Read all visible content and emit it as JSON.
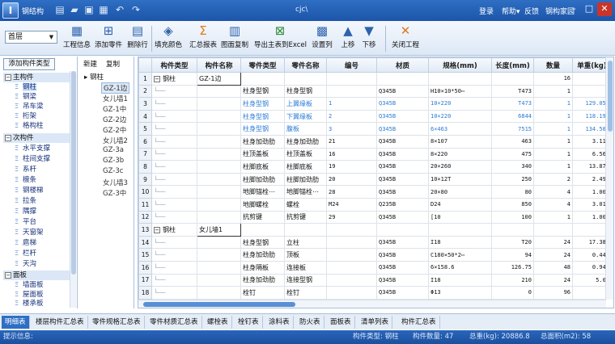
{
  "app": {
    "name": "钢结构",
    "window_title": "cjc\\",
    "menu_right": [
      "登录",
      "帮助",
      "反馈",
      "钢构家园"
    ]
  },
  "toolbar": {
    "floor": "首层",
    "buttons": [
      {
        "label": "工程信息",
        "icon": "table-icon"
      },
      {
        "label": "添加零件",
        "icon": "add-part-icon"
      },
      {
        "label": "删除行",
        "icon": "delete-row-icon"
      },
      {
        "label": "填充颜色",
        "icon": "fill-color-icon"
      },
      {
        "label": "汇总报表",
        "icon": "sum-icon"
      },
      {
        "label": "图面复制",
        "icon": "copy-icon"
      },
      {
        "label": "导出主表到Excel",
        "icon": "excel-icon"
      },
      {
        "label": "设置列",
        "icon": "columns-icon"
      },
      {
        "label": "上移",
        "icon": "arrow-up-icon"
      },
      {
        "label": "下移",
        "icon": "arrow-down-icon"
      },
      {
        "label": "关闭工程",
        "icon": "close-project-icon"
      }
    ]
  },
  "left_panel": {
    "tab_label": "添加构件类型",
    "categories": [
      {
        "label": "主构件",
        "items": [
          "钢柱",
          "钢梁",
          "吊车梁",
          "桁架",
          "格构柱"
        ]
      },
      {
        "label": "次构件",
        "items": [
          "水平支撑",
          "柱间支撑",
          "系杆",
          "檩条",
          "钢楼梯",
          "拉条",
          "隅撑",
          "平台",
          "天窗架",
          "扈梯",
          "栏杆",
          "天沟"
        ]
      },
      {
        "label": "面板",
        "items": [
          "墙面板",
          "屋面板",
          "楼承板"
        ]
      }
    ]
  },
  "mid_panel": {
    "new_label": "新建",
    "copy_label": "复制",
    "root": "钢柱",
    "items": [
      "GZ-1边",
      "女儿墙1",
      "GZ-1中",
      "GZ-2边",
      "GZ-2中",
      "女儿墙2",
      "GZ-3a",
      "GZ-3b",
      "GZ-3c",
      "女儿墙3",
      "GZ-3中"
    ]
  },
  "grid": {
    "columns": [
      "构件类型",
      "构件名称",
      "零件类型",
      "零件名称",
      "编号",
      "材质",
      "规格(mm)",
      "长度(mm)",
      "数量",
      "单重(kg)"
    ],
    "rows": [
      {
        "n": "1",
        "group": true,
        "type": "钢柱",
        "name": "GZ-1边",
        "ptype": "",
        "pname": "",
        "no": "",
        "mat": "",
        "spec": "",
        "len": "",
        "qty": "16",
        "w": ""
      },
      {
        "n": "2",
        "type": "",
        "name": "",
        "ptype": "柱身型钢",
        "pname": "柱身型钢",
        "no": "",
        "mat": "Q345B",
        "spec": "H10×10*50⋯",
        "len": "T473",
        "qty": "1",
        "w": ""
      },
      {
        "n": "3",
        "hl": true,
        "type": "",
        "name": "",
        "ptype": "柱身型钢",
        "pname": "上翼缘板",
        "no": "1",
        "mat": "Q345B",
        "spec": "10×220",
        "len": "T473",
        "qty": "1",
        "w": "129.059"
      },
      {
        "n": "4",
        "hl": true,
        "type": "",
        "name": "",
        "ptype": "柱身型钢",
        "pname": "下翼缘板",
        "no": "2",
        "mat": "Q345B",
        "spec": "10×220",
        "len": "6844",
        "qty": "1",
        "w": "118.196"
      },
      {
        "n": "5",
        "hl": true,
        "type": "",
        "name": "",
        "ptype": "柱身型钢",
        "pname": "腹板",
        "no": "3",
        "mat": "Q345B",
        "spec": "6×463",
        "len": "7515",
        "qty": "1",
        "w": "134.503"
      },
      {
        "n": "6",
        "type": "",
        "name": "",
        "ptype": "柱身加劲肋",
        "pname": "柱身加劲肋",
        "no": "21",
        "mat": "Q345B",
        "spec": "8×107",
        "len": "463",
        "qty": "1",
        "w": "3.111"
      },
      {
        "n": "7",
        "type": "",
        "name": "",
        "ptype": "柱顶盖板",
        "pname": "柱顶盖板",
        "no": "16",
        "mat": "Q345B",
        "spec": "8×220",
        "len": "475",
        "qty": "1",
        "w": "6.563"
      },
      {
        "n": "8",
        "type": "",
        "name": "",
        "ptype": "柱脚底板",
        "pname": "柱脚底板",
        "no": "19",
        "mat": "Q345B",
        "spec": "20×260",
        "len": "340",
        "qty": "1",
        "w": "13.879"
      },
      {
        "n": "9",
        "type": "",
        "name": "",
        "ptype": "柱脚加劲肋",
        "pname": "柱脚加劲肋",
        "no": "20",
        "mat": "Q345B",
        "spec": "10×12T",
        "len": "250",
        "qty": "2",
        "w": "2.492"
      },
      {
        "n": "10",
        "type": "",
        "name": "",
        "ptype": "地脚锚栓⋯",
        "pname": "地脚锚栓⋯",
        "no": "28",
        "mat": "Q345B",
        "spec": "20×80",
        "len": "80",
        "qty": "4",
        "w": "1.005"
      },
      {
        "n": "11",
        "type": "",
        "name": "",
        "ptype": "地脚螺栓",
        "pname": "螺栓",
        "no": "M24",
        "mat": "Q235B",
        "spec": "D24",
        "len": "850",
        "qty": "4",
        "w": "3.018"
      },
      {
        "n": "12",
        "type": "",
        "name": "",
        "ptype": "抗剪键",
        "pname": "抗剪键",
        "no": "29",
        "mat": "Q345B",
        "spec": "[10",
        "len": "100",
        "qty": "1",
        "w": "1.001"
      },
      {
        "n": "13",
        "group": true,
        "type": "钢柱",
        "name": "女儿墙1",
        "ptype": "",
        "pname": "",
        "no": "",
        "mat": "",
        "spec": "",
        "len": "",
        "qty": "",
        "w": ""
      },
      {
        "n": "14",
        "type": "",
        "name": "",
        "ptype": "柱身型钢",
        "pname": "立柱",
        "no": "",
        "mat": "Q345B",
        "spec": "I18",
        "len": "T20",
        "qty": "24",
        "w": "17.383"
      },
      {
        "n": "15",
        "type": "",
        "name": "",
        "ptype": "柱身加劲肋",
        "pname": "顶板",
        "no": "",
        "mat": "Q345B",
        "spec": "C180×50*2⋯",
        "len": "94",
        "qty": "24",
        "w": "0.449"
      },
      {
        "n": "16",
        "type": "",
        "name": "",
        "ptype": "柱身隔板",
        "pname": "连接板",
        "no": "",
        "mat": "Q345B",
        "spec": "6×158.6",
        "len": "126.75",
        "qty": "48",
        "w": "0.94T"
      },
      {
        "n": "17",
        "type": "",
        "name": "",
        "ptype": "柱身加劲肋",
        "pname": "连接型钢",
        "no": "",
        "mat": "Q345B",
        "spec": "I18",
        "len": "210",
        "qty": "24",
        "w": "5.0T"
      },
      {
        "n": "18",
        "type": "",
        "name": "",
        "ptype": "栓钉",
        "pname": "栓钉",
        "no": "",
        "mat": "Q345B",
        "spec": "Φ13",
        "len": "0",
        "qty": "96",
        "w": "0"
      }
    ]
  },
  "tabs": [
    "明细表",
    "楼层构件汇总表",
    "零件规格汇总表",
    "零件材质汇总表",
    "螺栓表",
    "栓钉表",
    "涂料表",
    "防火表",
    "面板表",
    "清单列表",
    "构件汇总表"
  ],
  "status": {
    "hint": "提示信息:",
    "type_label": "构件类型: 钢柱",
    "count_label": "构件数量: 47",
    "weight_label": "总重(kg): 20886.8",
    "area_label": "总面积(m2): 58"
  },
  "colors": {
    "title_bar": "#1c55a8",
    "highlight_text": "#2a7bd6",
    "active_tab": "#2e6fc4"
  }
}
